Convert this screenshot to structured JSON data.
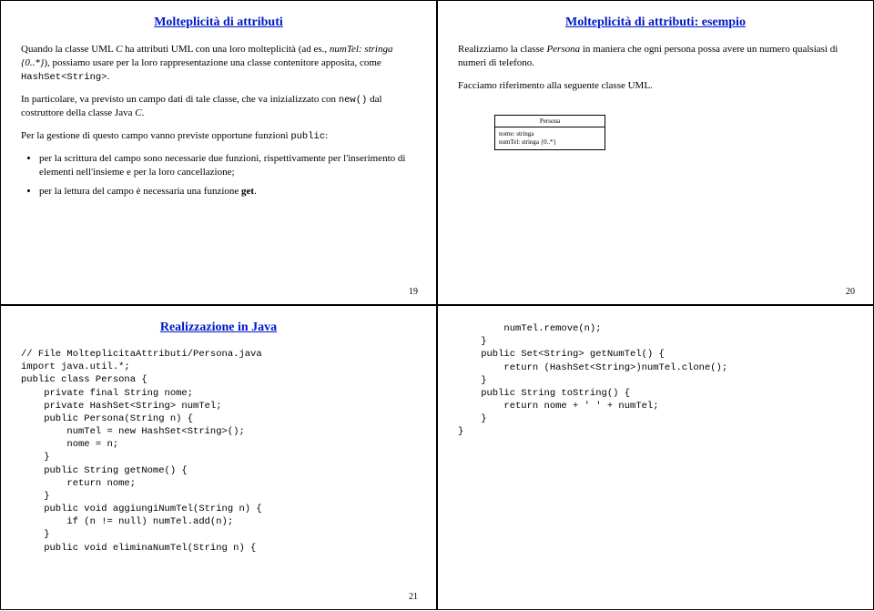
{
  "slide19": {
    "title": "Molteplicità di attributi",
    "p1a": "Quando la classe UML ",
    "p1b": "C",
    "p1c": " ha attributi UML con una loro molteplicità (ad es., ",
    "p1d": "numTel: stringa {0..*}",
    "p1e": "), possiamo usare per la loro rappresentazione una classe contenitore apposita, come ",
    "p1f": "HashSet<String>",
    "p1g": ".",
    "p2a": "In particolare, va previsto un campo dati di tale classe, che va inizializzato con ",
    "p2b": "new()",
    "p2c": " dal costruttore della classe Java ",
    "p2d": "C",
    "p2e": ".",
    "p3a": "Per la gestione di questo campo vanno previste opportune funzioni ",
    "p3b": "public",
    "p3c": ":",
    "b1": "per la scrittura del campo sono necessarie due funzioni, rispettivamente per l'inserimento di elementi nell'insieme e per la loro cancellazione;",
    "b2a": "per la lettura del campo è necessaria una funzione ",
    "b2b": "get",
    "b2c": ".",
    "pagenum": "19"
  },
  "slide20": {
    "title": "Molteplicità di attributi: esempio",
    "p1a": "Realizziamo la classe ",
    "p1b": "Persona",
    "p1c": " in maniera che ogni persona possa avere un numero qualsiasi di numeri di telefono.",
    "p2": "Facciamo riferimento alla seguente classe UML.",
    "uml": {
      "head": "Persona",
      "body": "nome: stringa\nnumTel: stringa {0..*}"
    },
    "pagenum": "20"
  },
  "slide21": {
    "title": "Realizzazione in Java",
    "code": "// File MolteplicitaAttributi/Persona.java\nimport java.util.*;\npublic class Persona {\n    private final String nome;\n    private HashSet<String> numTel;\n    public Persona(String n) {\n        numTel = new HashSet<String>();\n        nome = n;\n    }\n    public String getNome() {\n        return nome;\n    }\n    public void aggiungiNumTel(String n) {\n        if (n != null) numTel.add(n);\n    }\n    public void eliminaNumTel(String n) {",
    "pagenum": "21"
  },
  "slide22": {
    "code": "        numTel.remove(n);\n    }\n    public Set<String> getNumTel() {\n        return (HashSet<String>)numTel.clone();\n    }\n    public String toString() {\n        return nome + ' ' + numTel;\n    }\n}"
  }
}
